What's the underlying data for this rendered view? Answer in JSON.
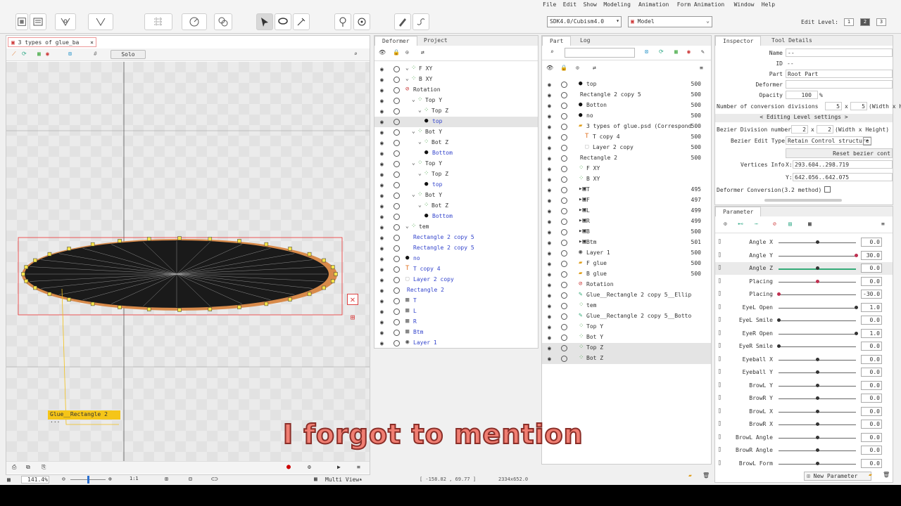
{
  "menu": [
    "File",
    "Edit",
    "Show",
    "Modeling",
    "Animation",
    "Form Animation",
    "Window",
    "Help"
  ],
  "sdk_combo": "SDK4.0/Cubism4.0",
  "mode_combo": "Model",
  "edit_level": {
    "label": "Edit Level:",
    "levels": [
      "1",
      "2",
      "3"
    ],
    "active": 1
  },
  "canvas": {
    "tab_title": "3 types of glue_ba",
    "solo_label": "Solo",
    "art_mesh_label": "Glue__Rectangle 2 ...",
    "zoom": "141.4",
    "ratio_label": "1:1",
    "view_mode": "Multi View"
  },
  "deformer_panel": {
    "tabs": [
      "Deformer",
      "Project"
    ],
    "rows": [
      {
        "label": "F XY",
        "indent": 0,
        "icon": "warp",
        "color": "black"
      },
      {
        "label": "B XY",
        "indent": 0,
        "icon": "warp",
        "color": "black"
      },
      {
        "label": "Rotation",
        "indent": 0,
        "icon": "rotation",
        "color": "black"
      },
      {
        "label": "Top Y",
        "indent": 1,
        "icon": "warp",
        "color": "black"
      },
      {
        "label": "Top Z",
        "indent": 2,
        "icon": "warp",
        "color": "black"
      },
      {
        "label": "top",
        "indent": 3,
        "icon": "dot",
        "color": "blue",
        "selected": true
      },
      {
        "label": "Bot Y",
        "indent": 1,
        "icon": "warp",
        "color": "black"
      },
      {
        "label": "Bot Z",
        "indent": 2,
        "icon": "warp",
        "color": "black"
      },
      {
        "label": "Bottom",
        "indent": 3,
        "icon": "dot",
        "color": "blue"
      },
      {
        "label": "Top Y",
        "indent": 1,
        "icon": "warp",
        "color": "black"
      },
      {
        "label": "Top Z",
        "indent": 2,
        "icon": "warp",
        "color": "black"
      },
      {
        "label": "top",
        "indent": 3,
        "icon": "dot",
        "color": "blue"
      },
      {
        "label": "Bot Y",
        "indent": 1,
        "icon": "warp",
        "color": "black"
      },
      {
        "label": "Bot Z",
        "indent": 2,
        "icon": "warp",
        "color": "black"
      },
      {
        "label": "Bottom",
        "indent": 3,
        "icon": "dot",
        "color": "blue"
      },
      {
        "label": "tem",
        "indent": 0,
        "icon": "warp",
        "color": "black"
      },
      {
        "label": "Rectangle 2 copy 5",
        "indent": 1,
        "icon": "none",
        "color": "blue"
      },
      {
        "label": "Rectangle 2 copy 5",
        "indent": 1,
        "icon": "none",
        "color": "blue"
      },
      {
        "label": "no",
        "indent": 0,
        "icon": "dot",
        "color": "blue"
      },
      {
        "label": "T copy 4",
        "indent": 0,
        "icon": "text",
        "color": "blue"
      },
      {
        "label": "Layer 2 copy",
        "indent": 0,
        "icon": "blank",
        "color": "blue"
      },
      {
        "label": "Rectangle 2",
        "indent": 0,
        "icon": "none",
        "color": "blue"
      },
      {
        "label": "T",
        "indent": 0,
        "icon": "gray",
        "color": "blue"
      },
      {
        "label": "L",
        "indent": 0,
        "icon": "gray",
        "color": "blue"
      },
      {
        "label": "R",
        "indent": 0,
        "icon": "gray",
        "color": "blue"
      },
      {
        "label": "Btm",
        "indent": 0,
        "icon": "gray",
        "color": "blue"
      },
      {
        "label": "Layer 1",
        "indent": 0,
        "icon": "gear",
        "color": "blue"
      }
    ]
  },
  "part_panel": {
    "tabs": [
      "Part",
      "Log"
    ],
    "rows": [
      {
        "label": "top",
        "num": "500",
        "indent": 0,
        "icon": "dot"
      },
      {
        "label": "Rectangle 2 copy 5",
        "num": "500",
        "indent": 0,
        "icon": "none"
      },
      {
        "label": "Botton",
        "num": "500",
        "indent": 0,
        "icon": "dot"
      },
      {
        "label": "no",
        "num": "500",
        "indent": 0,
        "icon": "dot"
      },
      {
        "label": "3 types of glue.psd (Correspond",
        "num": "500",
        "indent": 0,
        "icon": "folder"
      },
      {
        "label": "T copy 4",
        "num": "500",
        "indent": 1,
        "icon": "text"
      },
      {
        "label": "Layer 2 copy",
        "num": "500",
        "indent": 1,
        "icon": "blank"
      },
      {
        "label": "Rectangle 2",
        "num": "500",
        "indent": 0,
        "icon": "none"
      },
      {
        "label": "F XY",
        "num": "",
        "indent": 0,
        "icon": "warp"
      },
      {
        "label": "B XY",
        "num": "",
        "indent": 0,
        "icon": "warp"
      },
      {
        "label": "T",
        "num": "495",
        "indent": 0,
        "icon": "part"
      },
      {
        "label": "F",
        "num": "497",
        "indent": 0,
        "icon": "part"
      },
      {
        "label": "L",
        "num": "499",
        "indent": 0,
        "icon": "part"
      },
      {
        "label": "R",
        "num": "499",
        "indent": 0,
        "icon": "part"
      },
      {
        "label": "B",
        "num": "500",
        "indent": 0,
        "icon": "part"
      },
      {
        "label": "Btm",
        "num": "501",
        "indent": 0,
        "icon": "part"
      },
      {
        "label": "Layer 1",
        "num": "500",
        "indent": 0,
        "icon": "gear"
      },
      {
        "label": "F glue",
        "num": "500",
        "indent": 0,
        "icon": "folder"
      },
      {
        "label": "B glue",
        "num": "500",
        "indent": 0,
        "icon": "folder"
      },
      {
        "label": "Rotation",
        "num": "",
        "indent": 0,
        "icon": "rotation"
      },
      {
        "label": "Glue__Rectangle 2 copy 5__Ellip",
        "num": "",
        "indent": 0,
        "icon": "glue"
      },
      {
        "label": "tem",
        "num": "",
        "indent": 0,
        "icon": "warp"
      },
      {
        "label": "Glue__Rectangle 2 copy 5__Botto",
        "num": "",
        "indent": 0,
        "icon": "glue"
      },
      {
        "label": "Top Y",
        "num": "",
        "indent": 0,
        "icon": "warp"
      },
      {
        "label": "Bot Y",
        "num": "",
        "indent": 0,
        "icon": "warp"
      },
      {
        "label": "Top Z",
        "num": "",
        "indent": 0,
        "icon": "warp",
        "selected": true
      },
      {
        "label": "Bot Z",
        "num": "",
        "indent": 0,
        "icon": "warp",
        "selected": true
      }
    ]
  },
  "inspector": {
    "tabs": [
      "Inspector",
      "Tool Details"
    ],
    "name_label": "Name",
    "name_value": "--",
    "id_label": "ID",
    "id_value": "--",
    "part_label": "Part",
    "part_value": "Root Part",
    "deformer_label": "Deformer",
    "deformer_value": "",
    "opacity_label": "Opacity",
    "opacity_value": "100",
    "opacity_unit": "%",
    "conv_label": "Number of conversion divisions",
    "conv_w": "5",
    "conv_h": "5",
    "conv_suffix": "(Width x He",
    "editing_level": "< Editing Level settings >",
    "bezier_div_label": "Bezier Division number",
    "bezier_w": "2",
    "bezier_h": "2",
    "bezier_suffix": "(Width x Height)",
    "bezier_type_label": "Bezier Edit Type",
    "bezier_type_value": "Retain Control structure",
    "reset_label": "Reset bezier cont",
    "vertices_label": "Vertices Info",
    "vx": "X:",
    "vx_value": "293.604..298.719",
    "vy": "Y:",
    "vy_value": "642.056..642.075",
    "deformer_conv_label": "Deformer Conversion(3.2 method)"
  },
  "parameter_panel": {
    "tab": "Parameter",
    "new_parameter": "New Parameter",
    "params": [
      {
        "name": "Angle X",
        "value": "0.0",
        "pos": 0.5
      },
      {
        "name": "Angle Y",
        "value": "30.0",
        "pos": 1.0
      },
      {
        "name": "Angle Z",
        "value": "0.0",
        "pos": 0.5
      },
      {
        "name": "Placing",
        "value": "0.0",
        "pos": 0.5
      },
      {
        "name": "Placing",
        "value": "-30.0",
        "pos": 0.0
      },
      {
        "name": "EyeL Open",
        "value": "1.0",
        "pos": 1.0
      },
      {
        "name": "EyeL Smile",
        "value": "0.0",
        "pos": 0.0
      },
      {
        "name": "EyeR Open",
        "value": "1.0",
        "pos": 1.0
      },
      {
        "name": "EyeR Smile",
        "value": "0.0",
        "pos": 0.0
      },
      {
        "name": "Eyeball X",
        "value": "0.0",
        "pos": 0.5
      },
      {
        "name": "Eyeball Y",
        "value": "0.0",
        "pos": 0.5
      },
      {
        "name": "BrowL Y",
        "value": "0.0",
        "pos": 0.5
      },
      {
        "name": "BrowR Y",
        "value": "0.0",
        "pos": 0.5
      },
      {
        "name": "BrowL X",
        "value": "0.0",
        "pos": 0.5
      },
      {
        "name": "BrowR X",
        "value": "0.0",
        "pos": 0.5
      },
      {
        "name": "BrowL Angle",
        "value": "0.0",
        "pos": 0.5
      },
      {
        "name": "BrowR Angle",
        "value": "0.0",
        "pos": 0.5
      },
      {
        "name": "BrowL Form",
        "value": "0.0",
        "pos": 0.5
      }
    ]
  },
  "status_bar": {
    "coords": "[ -158.82 ,   69.77 ]",
    "size": "2334x652.0"
  },
  "caption": "I forgot to mention"
}
